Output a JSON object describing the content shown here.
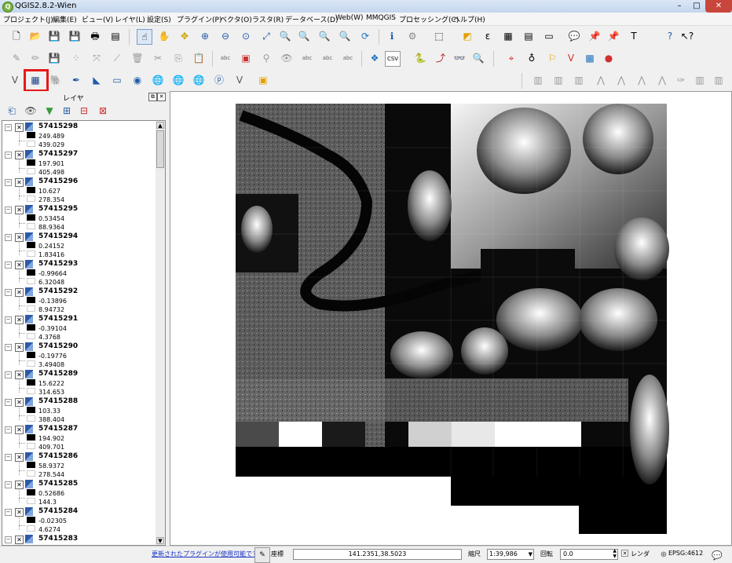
{
  "window": {
    "title": "QGIS2.8.2-Wien",
    "app_icon": "Q",
    "minimize": "–",
    "maximize": "□",
    "close": "✕"
  },
  "menu": [
    {
      "label": "プロジェクト(J)"
    },
    {
      "label": "編集(E)"
    },
    {
      "label": "ビュー(V)"
    },
    {
      "label": "レイヤ(L)"
    },
    {
      "label": "設定(S)"
    },
    {
      "label": "プラグイン(P)"
    },
    {
      "label": "ベクタ(O)"
    },
    {
      "label": "ラスタ(R)"
    },
    {
      "label": "データベース(D)"
    },
    {
      "label": "Web(W)"
    },
    {
      "label": "MMQGIS"
    },
    {
      "label": "プロセッシング(C)"
    },
    {
      "label": "ヘルプ(H)"
    }
  ],
  "toolbar_icons": {
    "row1": [
      "new-project",
      "open-project",
      "save-project",
      "save-as",
      "print-composer",
      "composer-manager",
      "touch-zoom",
      "pan",
      "pan-to-selection",
      "zoom-in",
      "zoom-out",
      "zoom-actual",
      "zoom-full",
      "zoom-layer",
      "zoom-selection",
      "zoom-last",
      "zoom-next",
      "refresh",
      "identify",
      "measure",
      "select",
      "deselect",
      "field-calculator",
      "attribute-table",
      "statistics",
      "new-bookmark",
      "annotation",
      "text-annotation",
      "help",
      "whats-this"
    ],
    "row3_text": {
      "csv": "CSV",
      "abc": "abc"
    }
  },
  "layers_panel": {
    "title": "レイヤ",
    "float": "⧉",
    "close": "✕"
  },
  "layers": [
    {
      "name": "57415298",
      "min": "249.489",
      "max": "439.029"
    },
    {
      "name": "57415297",
      "min": "197.901",
      "max": "405.498"
    },
    {
      "name": "57415296",
      "min": "10.627",
      "max": "278.354"
    },
    {
      "name": "57415295",
      "min": "0.53454",
      "max": "88.9364"
    },
    {
      "name": "57415294",
      "min": "0.24152",
      "max": "1.83416"
    },
    {
      "name": "57415293",
      "min": "-0.99664",
      "max": "6.32048"
    },
    {
      "name": "57415292",
      "min": "-0.13896",
      "max": "8.94732"
    },
    {
      "name": "57415291",
      "min": "-0.39104",
      "max": "4.3768"
    },
    {
      "name": "57415290",
      "min": "-0.19776",
      "max": "3.49408"
    },
    {
      "name": "57415289",
      "min": "15.6222",
      "max": "314.653"
    },
    {
      "name": "57415288",
      "min": "103.33",
      "max": "388.404"
    },
    {
      "name": "57415287",
      "min": "194.902",
      "max": "409.701"
    },
    {
      "name": "57415286",
      "min": "58.9372",
      "max": "278.544"
    },
    {
      "name": "57415285",
      "min": "0.52686",
      "max": "144.3"
    },
    {
      "name": "57415284",
      "min": "-0.02305",
      "max": "4.6274"
    },
    {
      "name": "57415283",
      "min": "",
      "max": ""
    }
  ],
  "status": {
    "plugin_notice": "更新されたプラグインが使用可能です",
    "coord_label": "座標",
    "coord_value": "141.2351,38.5023",
    "scale_label": "縮尺",
    "scale_value": "1:39,986",
    "rotation_label": "回転",
    "rotation_value": "0.0",
    "render_label": "レンダ",
    "render_checked": "✕",
    "crs": "EPSG:4612"
  }
}
